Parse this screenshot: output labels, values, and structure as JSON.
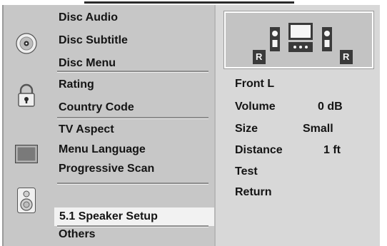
{
  "menu": {
    "disc_audio": "Disc Audio",
    "disc_subtitle": "Disc Subtitle",
    "disc_menu": "Disc Menu",
    "rating": "Rating",
    "country_code": "Country Code",
    "tv_aspect": "TV Aspect",
    "menu_language": "Menu Language",
    "progressive_scan": "Progressive Scan",
    "speaker_setup": "5.1 Speaker Setup",
    "others": "Others"
  },
  "speaker_panel": {
    "left_letter": "R",
    "right_letter": "R",
    "channel": "Front L",
    "rows": [
      {
        "label": "Volume",
        "value": "0 dB"
      },
      {
        "label": "Size",
        "value": "Small"
      },
      {
        "label": "Distance",
        "value": "1 ft"
      }
    ],
    "test": "Test",
    "return": "Return"
  },
  "icons": {
    "disc": "disc-icon",
    "lock": "lock-icon",
    "tv": "tv-icon",
    "speaker": "speaker-icon"
  },
  "colors": {
    "left_panel": "#c7c7c7",
    "right_panel": "#d8d8d8",
    "selected_row": "#f2f2f2",
    "text": "#141414"
  }
}
